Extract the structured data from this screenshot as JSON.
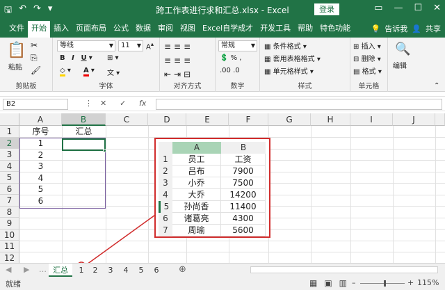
{
  "titlebar": {
    "title": "跨工作表进行求和汇总.xlsx - Excel",
    "login": "登录"
  },
  "menu": {
    "items": [
      "文件",
      "开始",
      "插入",
      "页面布局",
      "公式",
      "数据",
      "审阅",
      "视图",
      "Excel自学成才",
      "开发工具",
      "帮助",
      "特色功能"
    ],
    "tellme": "告诉我",
    "share": "共享"
  },
  "ribbon": {
    "paste": "粘贴",
    "clipboard": "剪贴板",
    "font_name": "等线",
    "font_size": "11",
    "font_group": "字体",
    "align_group": "对齐方式",
    "number_format": "常规",
    "number_group": "数字",
    "cond_format": "条件格式",
    "table_format": "套用表格格式",
    "cell_style": "单元格样式",
    "style_group": "样式",
    "insert": "插入",
    "delete": "删除",
    "format": "格式",
    "cells_group": "单元格",
    "edit": "编辑"
  },
  "formula": {
    "namebox": "B2"
  },
  "grid": {
    "columns": [
      "A",
      "B",
      "C",
      "D",
      "E",
      "F",
      "G",
      "H",
      "I",
      "J"
    ],
    "rows": [
      "1",
      "2",
      "3",
      "4",
      "5",
      "6",
      "7",
      "8",
      "9",
      "10",
      "11",
      "12"
    ],
    "a1": "序号",
    "b1": "汇总",
    "a_values": [
      "1",
      "2",
      "3",
      "4",
      "5",
      "6"
    ]
  },
  "picture": {
    "col_a": "A",
    "col_b": "B",
    "row_nums": [
      "1",
      "2",
      "3",
      "4",
      "5",
      "6",
      "7"
    ],
    "header": [
      "员工",
      "工资"
    ],
    "rows": [
      [
        "吕布",
        "7900"
      ],
      [
        "小乔",
        "7500"
      ],
      [
        "大乔",
        "14200"
      ],
      [
        "孙尚香",
        "11400"
      ],
      [
        "诸葛亮",
        "4300"
      ],
      [
        "周瑜",
        "5600"
      ]
    ]
  },
  "sheets": [
    "汇总",
    "1",
    "2",
    "3",
    "4",
    "5",
    "6"
  ],
  "status": {
    "ready": "就绪",
    "zoom": "115%"
  },
  "colors": {
    "accent": "#217346",
    "highlight": "#d12d2d"
  }
}
